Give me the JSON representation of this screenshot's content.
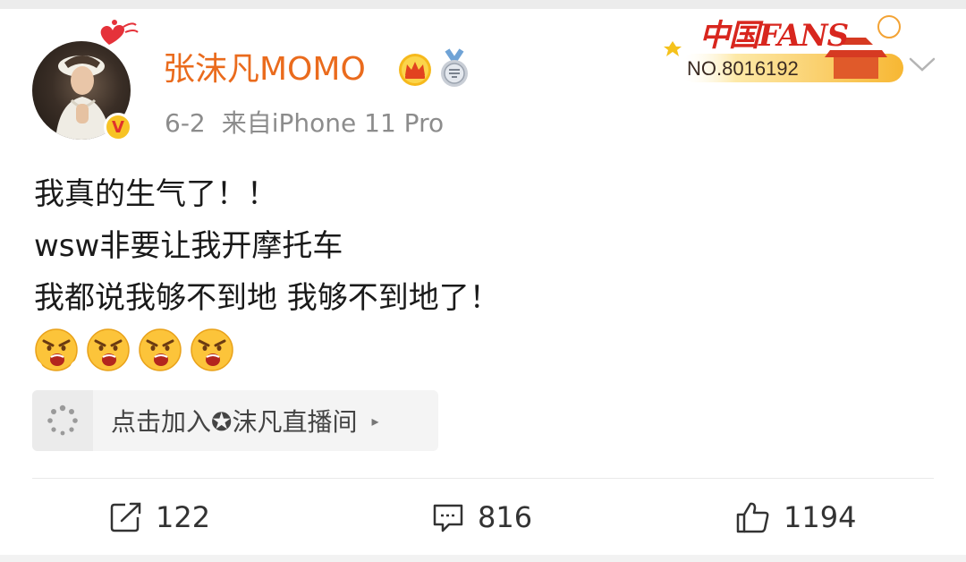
{
  "user": {
    "name": "张沫凡MOMO",
    "verified_mark": "V"
  },
  "post": {
    "date": "6-2",
    "source": "来自iPhone 11 Pro",
    "lines": [
      "我真的生气了！！",
      "wsw非要让我开摩托车",
      "我都说我够不到地 我够不到地了！"
    ],
    "emoji": [
      "angry-face-icon",
      "angry-face-icon",
      "angry-face-icon",
      "angry-face-icon"
    ]
  },
  "fan_badge": {
    "title": "中国FANS",
    "number": "NO.8016192"
  },
  "live_card": {
    "label": "点击加入✪沫凡直播间",
    "arrow": "▸"
  },
  "actions": {
    "repost": "122",
    "comment": "816",
    "like": "1194"
  },
  "colors": {
    "name": "#ea6b1d",
    "meta": "#8c8c8c",
    "verified": "#f7c325"
  }
}
